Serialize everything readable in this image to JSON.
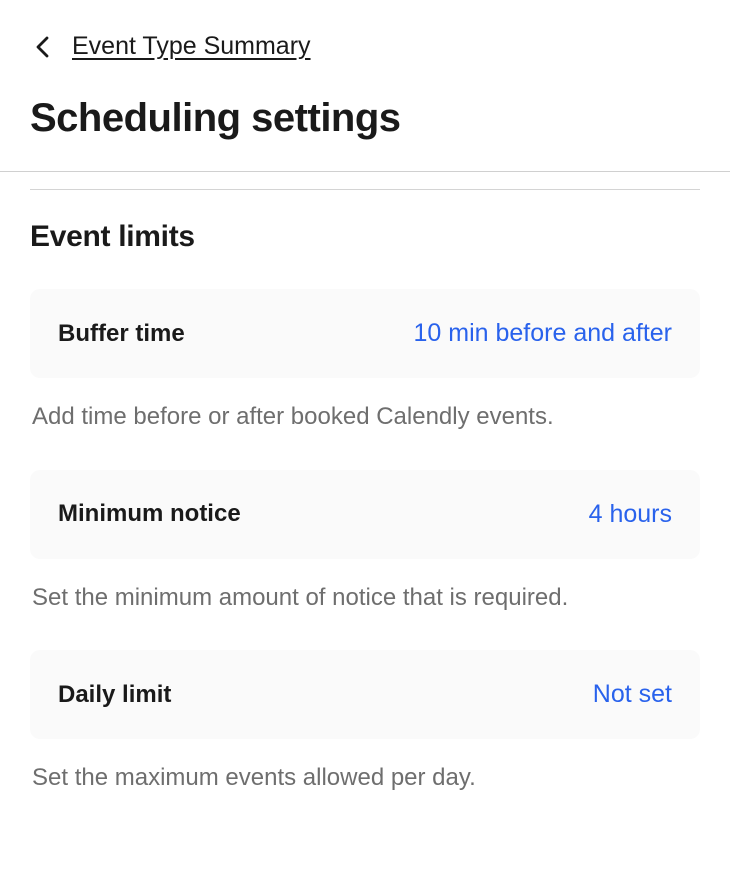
{
  "breadcrumb": {
    "label": "Event Type Summary"
  },
  "page": {
    "title": "Scheduling settings"
  },
  "section": {
    "title": "Event limits"
  },
  "settings": {
    "buffer": {
      "label": "Buffer time",
      "value": "10 min before and after",
      "description": "Add time before or after booked Calendly events."
    },
    "notice": {
      "label": "Minimum notice",
      "value": "4 hours",
      "description": "Set the minimum amount of notice that is required."
    },
    "daily": {
      "label": "Daily limit",
      "value": "Not set",
      "description": "Set the maximum events allowed per day."
    }
  }
}
